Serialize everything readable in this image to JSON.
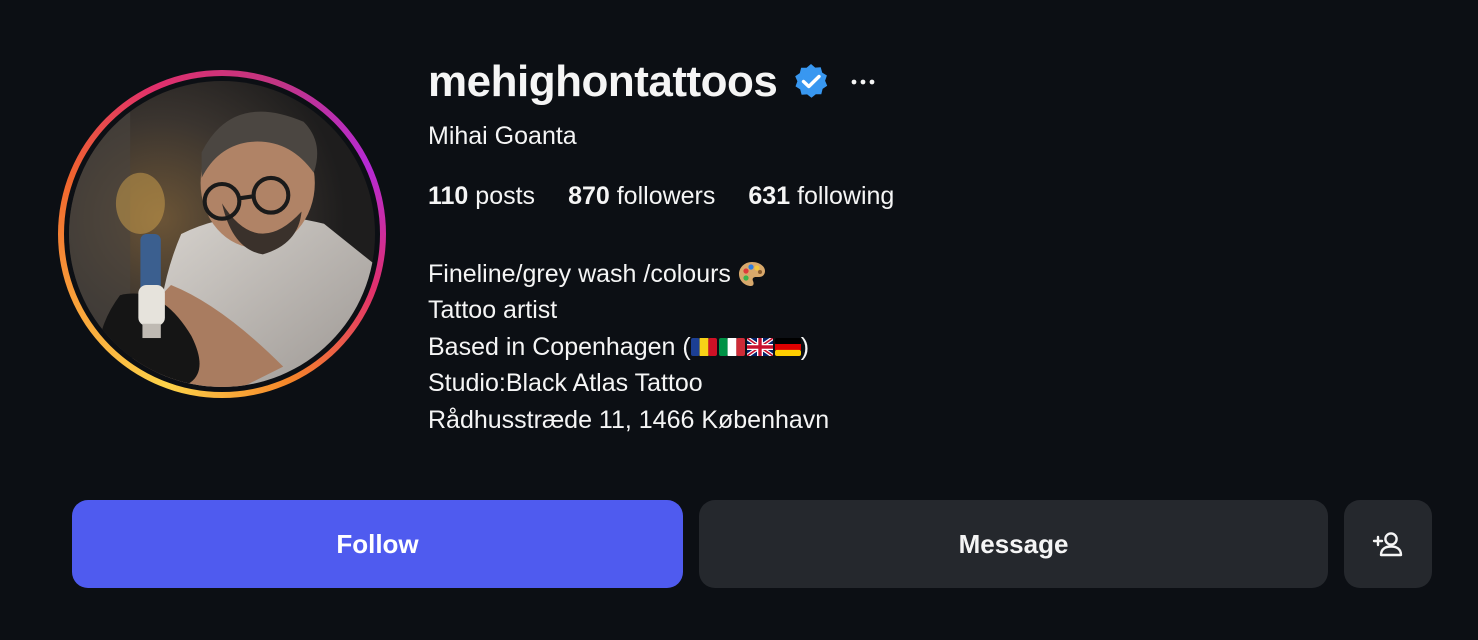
{
  "profile": {
    "username": "mehighontattoos",
    "full_name": "Mihai Goanta",
    "verified": true
  },
  "stats": {
    "posts_count": "110",
    "posts_label": "posts",
    "followers_count": "870",
    "followers_label": "followers",
    "following_count": "631",
    "following_label": "following"
  },
  "bio": {
    "line1": "Fineline/grey wash /colours",
    "line2": "Tattoo artist",
    "line3_prefix": "Based in Copenhagen (",
    "line3_suffix": ")",
    "line4": "Studio:Black Atlas Tattoo",
    "line5": "Rådhusstræde 11, 1466 København"
  },
  "buttons": {
    "follow": "Follow",
    "message": "Message"
  },
  "icons": {
    "verified": "verified-badge-icon",
    "more": "more-options-icon",
    "palette": "artist-palette-icon",
    "flags": [
      "romania-flag-icon",
      "italy-flag-icon",
      "uk-flag-icon",
      "germany-flag-icon"
    ],
    "suggest": "add-person-icon"
  },
  "colors": {
    "background": "#0c0f14",
    "follow_button": "#4f5bef",
    "secondary_button": "#25282d",
    "verified": "#3897f0"
  }
}
